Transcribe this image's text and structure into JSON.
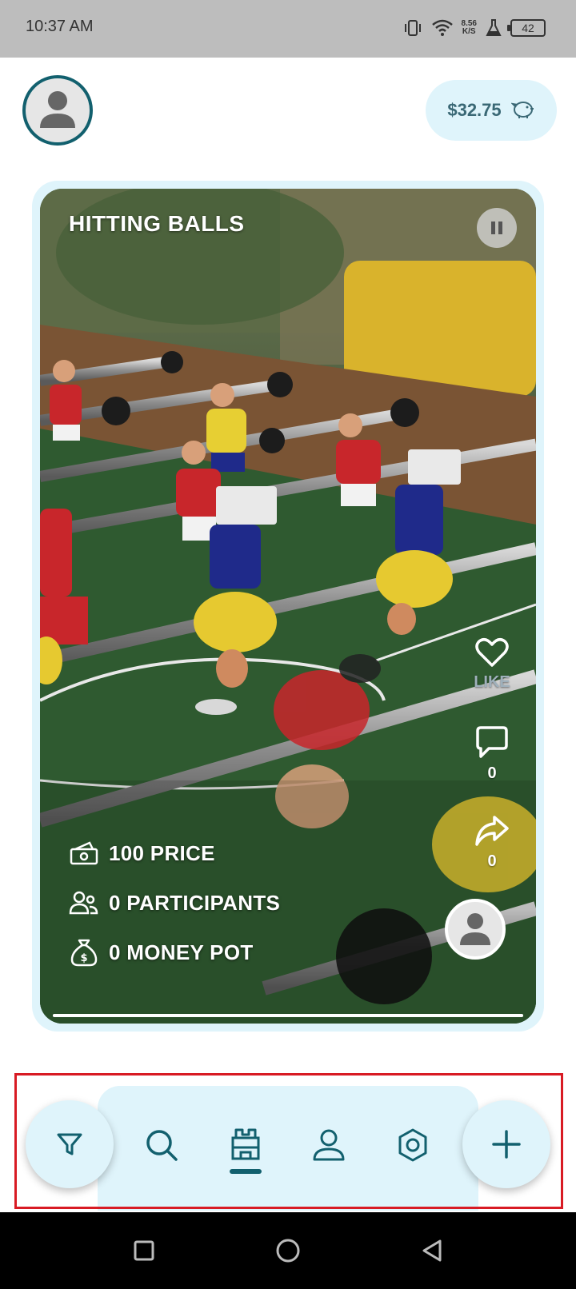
{
  "status_bar": {
    "time": "10:37 AM",
    "net_speed_value": "8.56",
    "net_speed_unit": "K/S",
    "battery": "42",
    "icons": [
      "vibrate-icon",
      "wifi-icon",
      "flask-icon",
      "battery-icon"
    ]
  },
  "header": {
    "wallet_amount": "$32.75",
    "wallet_icon": "piggy-bank-icon"
  },
  "video": {
    "title": "HITTING BALLS",
    "progress": 1.0
  },
  "actions": {
    "like_label": "LIKE",
    "comment_count": "0",
    "share_count": "0"
  },
  "stats": {
    "price": "100 PRICE",
    "participants": "0 PARTICIPANTS",
    "money_pot": "0 MONEY POT"
  },
  "nav": {
    "items": [
      "filter-icon",
      "search-icon",
      "arena-icon",
      "profile-icon",
      "settings-icon",
      "add-icon"
    ],
    "active": "arena-icon"
  },
  "colors": {
    "accent": "#12606e",
    "pill_bg": "#dff4fb",
    "highlight_border": "#d81b24"
  }
}
